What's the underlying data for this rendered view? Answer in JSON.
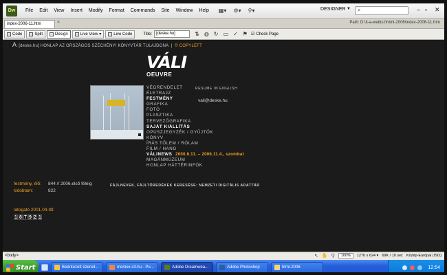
{
  "app": {
    "logo_text": "Dw",
    "menu": [
      "File",
      "Edit",
      "View",
      "Insert",
      "Modify",
      "Format",
      "Commands",
      "Site",
      "Window",
      "Help"
    ],
    "workspace": "DESIGNER",
    "window_controls": [
      "–",
      "▫",
      "✕"
    ]
  },
  "tabs": {
    "doc_tab": "index-2006-11.htm",
    "close": "×",
    "path": "Path: D:\\l\\-a-webisz\\html-2006\\index-2006-11.htm"
  },
  "doc_toolbar": {
    "code": "Code",
    "split": "Split",
    "design": "Design",
    "live_view": "Live View",
    "live_code": "Live Code",
    "title_label": "Title:",
    "title_value": "[deske.hu]",
    "check_page": "Check Page"
  },
  "page": {
    "header_a": "A",
    "header": "[deske.hu] HONLAP AZ ORSZÁGOS SZÉCHÉNYI KÖNYVTÁR TULAJDONA",
    "copyleft": "© COPYLEFT",
    "logo_line1": "VÁLI",
    "logo_line2": "OEUVRE",
    "resume": "RESUME IN ENGLISH",
    "email": "vali@deske.hu",
    "nav": [
      {
        "text": "VÉGRENDELET",
        "bold": false
      },
      {
        "text": "ÉLETRAJZ",
        "bold": false
      },
      {
        "text": "FESTMÉNY",
        "bold": true
      },
      {
        "text": "GRAFIKA",
        "bold": false
      },
      {
        "text": "FOTÓ",
        "bold": false
      },
      {
        "text": "PLASZTIKA",
        "bold": false
      },
      {
        "text": "TERVEZŐGRAFIKA",
        "bold": false
      },
      {
        "text": "SAJÁT KIÁLLÍTÁS",
        "bold": true
      },
      {
        "text": "OPUSZJEGYZÉK / GYŰJTŐK",
        "bold": false
      },
      {
        "text": "KÖNYV",
        "bold": false
      },
      {
        "text": "ÍRÁS TŐLEM / RÓLAM",
        "bold": false
      },
      {
        "text": "FILM / HANG",
        "bold": false
      },
      {
        "text": "VÁLINEWS",
        "bold": true,
        "extra": "2000.6.11. – 2006.11.4., szombat"
      },
      {
        "text": "MAGÁNMÚZEUM",
        "bold": false
      },
      {
        "text": "HONLAP HÁTTÉRINFÓK",
        "bold": false
      }
    ],
    "stats": {
      "festmeny_label": "festmény, élő:",
      "festmeny_value": "844 // 2006.első féléig",
      "kidobtam_label": "kidobtam:",
      "kidobtam_value": "822",
      "fajlnevek": "FÁJLNEVEK, FÁJLTÖREDÉKEK KERESÉSE: NEMZETI DIGITÁLIS ADATTÁR",
      "latogato_label": "látogató 2001.04-től:",
      "counter": [
        "1",
        "8",
        "7",
        "9",
        "2",
        "1"
      ]
    }
  },
  "status": {
    "tag": "<body>",
    "zoom": "100%",
    "dims": "1270 x 624 ▾",
    "size": "69K / 10 sec",
    "encoding": "Közép-Európai (ISO)"
  },
  "taskbar": {
    "start": "Start",
    "buttons": [
      {
        "label": "Beérkezett üzenet...",
        "color": "#f2c44a"
      },
      {
        "label": "memex.c3.hu - Pu...",
        "color": "#e9864a"
      },
      {
        "label": "Adobe Dreamwea...",
        "color": "#5b7a25",
        "active": true
      },
      {
        "label": "Adobe Photoshop",
        "color": "#2a5fa6"
      },
      {
        "label": "html-2006",
        "color": "#f4d37a"
      }
    ],
    "clock": "12:54"
  }
}
